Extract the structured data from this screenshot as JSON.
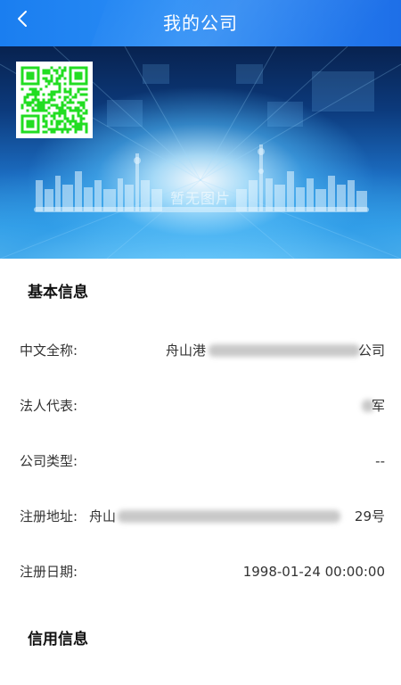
{
  "header": {
    "title": "我的公司",
    "back_icon": "chevron-left-icon"
  },
  "banner": {
    "placeholder_text": "暂无图片",
    "qr_icon": "qr-code-icon",
    "qr_color": "#22dd22"
  },
  "basic_info": {
    "section_title": "基本信息",
    "rows": [
      {
        "label": "中文全称:",
        "value_start": "舟山港",
        "value_end": "公司"
      },
      {
        "label": "法人代表:",
        "value_end": "军"
      },
      {
        "label": "公司类型:",
        "value_end": "--"
      },
      {
        "label": "注册地址:",
        "value_start": "舟山",
        "value_end": "29号"
      },
      {
        "label": "注册日期:",
        "value_end": "1998-01-24 00:00:00"
      }
    ]
  },
  "credit_info": {
    "section_title": "信用信息"
  },
  "colors": {
    "header_blue": "#1a7ef0",
    "text_dark": "#333333"
  }
}
